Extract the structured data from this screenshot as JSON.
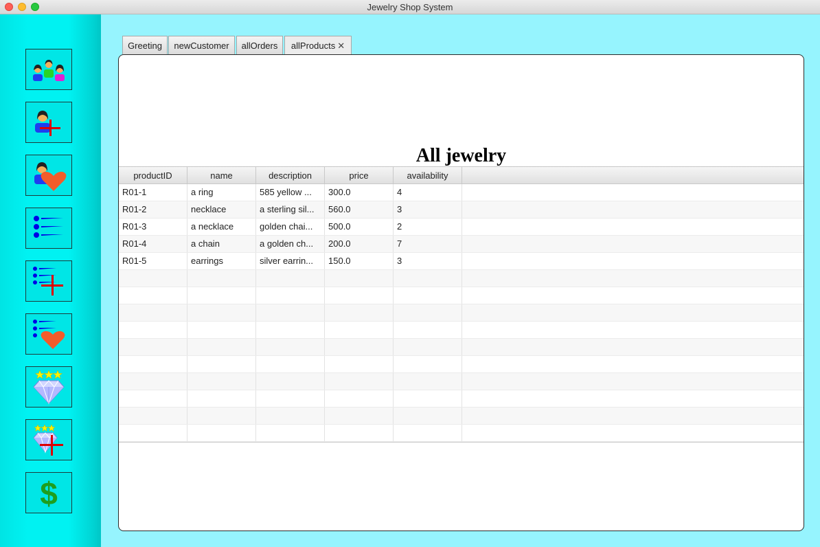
{
  "window": {
    "title": "Jewelry Shop System"
  },
  "sidebar": {
    "buttons": [
      {
        "name": "customers-list-button",
        "icon": "customers-group-icon"
      },
      {
        "name": "add-customer-button",
        "icon": "add-customer-icon"
      },
      {
        "name": "favorite-customer-button",
        "icon": "customer-heart-icon"
      },
      {
        "name": "orders-list-button",
        "icon": "list-icon"
      },
      {
        "name": "add-order-button",
        "icon": "list-add-icon"
      },
      {
        "name": "favorite-orders-button",
        "icon": "list-heart-icon"
      },
      {
        "name": "products-button",
        "icon": "diamond-stars-icon"
      },
      {
        "name": "add-product-button",
        "icon": "diamond-add-icon"
      },
      {
        "name": "payments-button",
        "icon": "dollar-icon"
      }
    ]
  },
  "tabs": [
    {
      "label": "Greeting"
    },
    {
      "label": "newCustomer"
    },
    {
      "label": "allOrders"
    },
    {
      "label": "allProducts",
      "active": true,
      "close": "✕"
    }
  ],
  "main": {
    "heading": "All jewelry",
    "table": {
      "columns": [
        "productID",
        "name",
        "description",
        "price",
        "availability"
      ],
      "rows": [
        [
          "R01-1",
          "a ring",
          "585 yellow ...",
          "300.0",
          "4"
        ],
        [
          "R01-2",
          "necklace",
          "a sterling sil...",
          "560.0",
          "3"
        ],
        [
          "R01-3",
          "a necklace",
          "golden chai...",
          "500.0",
          "2"
        ],
        [
          "R01-4",
          "a chain",
          "a golden ch...",
          "200.0",
          "7"
        ],
        [
          "R01-5",
          "earrings",
          "silver earrin...",
          "150.0",
          "3"
        ]
      ],
      "empty_rows": 10
    }
  },
  "colors": {
    "background": "#96f4fe",
    "sidebar": "#00f2f2",
    "icon_blue": "#0000e6",
    "icon_red": "#dd0000",
    "icon_heart": "#f25c2a",
    "icon_star": "#fff200",
    "icon_dollar": "#1e9e1e"
  }
}
